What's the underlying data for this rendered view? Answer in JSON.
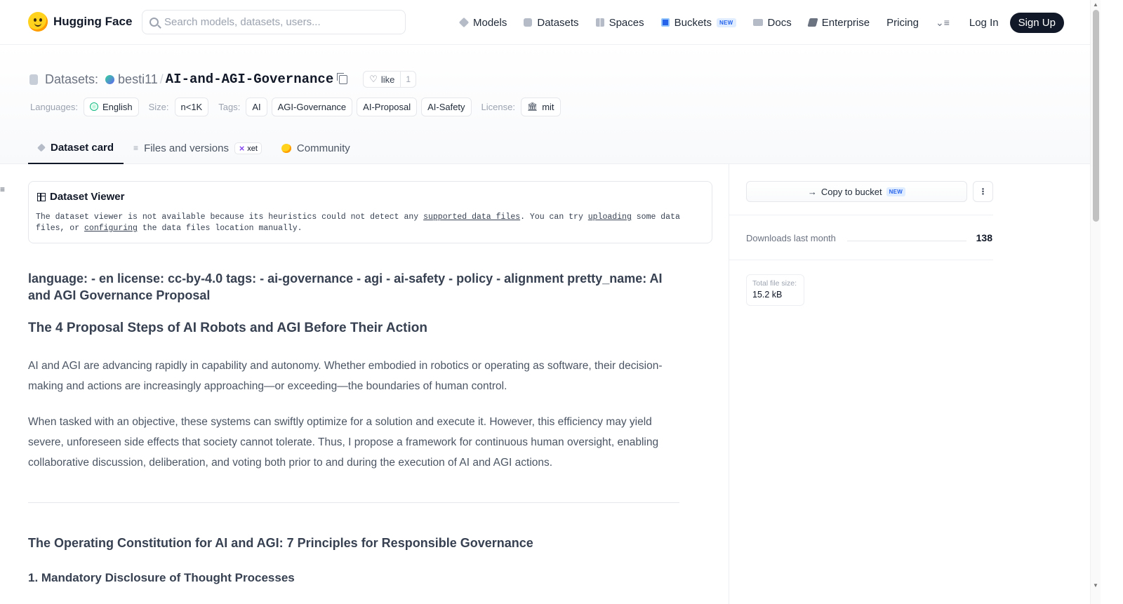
{
  "nav": {
    "logo_text": "Hugging Face",
    "search_placeholder": "Search models, datasets, users...",
    "items": [
      {
        "label": "Models",
        "icon": "models-icon"
      },
      {
        "label": "Datasets",
        "icon": "datasets-icon"
      },
      {
        "label": "Spaces",
        "icon": "spaces-icon"
      },
      {
        "label": "Buckets",
        "icon": "buckets-icon",
        "badge": "NEW"
      },
      {
        "label": "Docs",
        "icon": "docs-icon"
      },
      {
        "label": "Enterprise",
        "icon": "enterprise-icon"
      },
      {
        "label": "Pricing"
      }
    ],
    "login": "Log In",
    "signup": "Sign Up"
  },
  "header": {
    "prefix": "Datasets:",
    "user": "besti11",
    "separator": "/",
    "name": "AI-and-AGI-Governance",
    "like_label": "like",
    "like_count": "1",
    "languages_label": "Languages:",
    "language": "English",
    "size_label": "Size:",
    "size": "n<1K",
    "tags_label": "Tags:",
    "tags": [
      "AI",
      "AGI-Governance",
      "AI-Proposal",
      "AI-Safety"
    ],
    "license_label": "License:",
    "license": "mit"
  },
  "tabs": [
    {
      "label": "Dataset card",
      "active": true
    },
    {
      "label": "Files and versions",
      "badge": "xet"
    },
    {
      "label": "Community"
    }
  ],
  "viewer": {
    "title": "Dataset Viewer",
    "msg_part1": "The dataset viewer is not available because its heuristics could not detect any ",
    "link1": "supported data files",
    "msg_part2": ". You can try ",
    "link2": "uploading",
    "msg_part3": " some data files, or ",
    "link3": "configuring",
    "msg_part4": " the data files location manually."
  },
  "card": {
    "yaml_heading": "language: - en license: cc-by-4.0 tags: - ai-governance - agi - ai-safety - policy - alignment pretty_name: AI and AGI Governance Proposal",
    "h2_proposal": "The 4 Proposal Steps of AI Robots and AGI Before Their Action",
    "para1": "AI and AGI are advancing rapidly in capability and autonomy. Whether embodied in robotics or operating as software, their decision-making and actions are increasingly approaching—or exceeding—the boundaries of human control.",
    "para2": "When tasked with an objective, these systems can swiftly optimize for a solution and execute it. However, this efficiency may yield severe, unforeseen side effects that society cannot tolerate. Thus, I propose a framework for continuous human oversight, enabling collaborative discussion, deliberation, and voting both prior to and during the execution of AI and AGI actions.",
    "h2_constitution": "The Operating Constitution for AI and AGI: 7 Principles for Responsible Governance",
    "h3_first": "1. Mandatory Disclosure of Thought Processes"
  },
  "sidebar": {
    "copy_bucket": "Copy to bucket",
    "copy_badge": "NEW",
    "downloads_label": "Downloads last month",
    "downloads_value": "138",
    "size_label": "Total file size:",
    "size_value": "15.2 kB"
  }
}
